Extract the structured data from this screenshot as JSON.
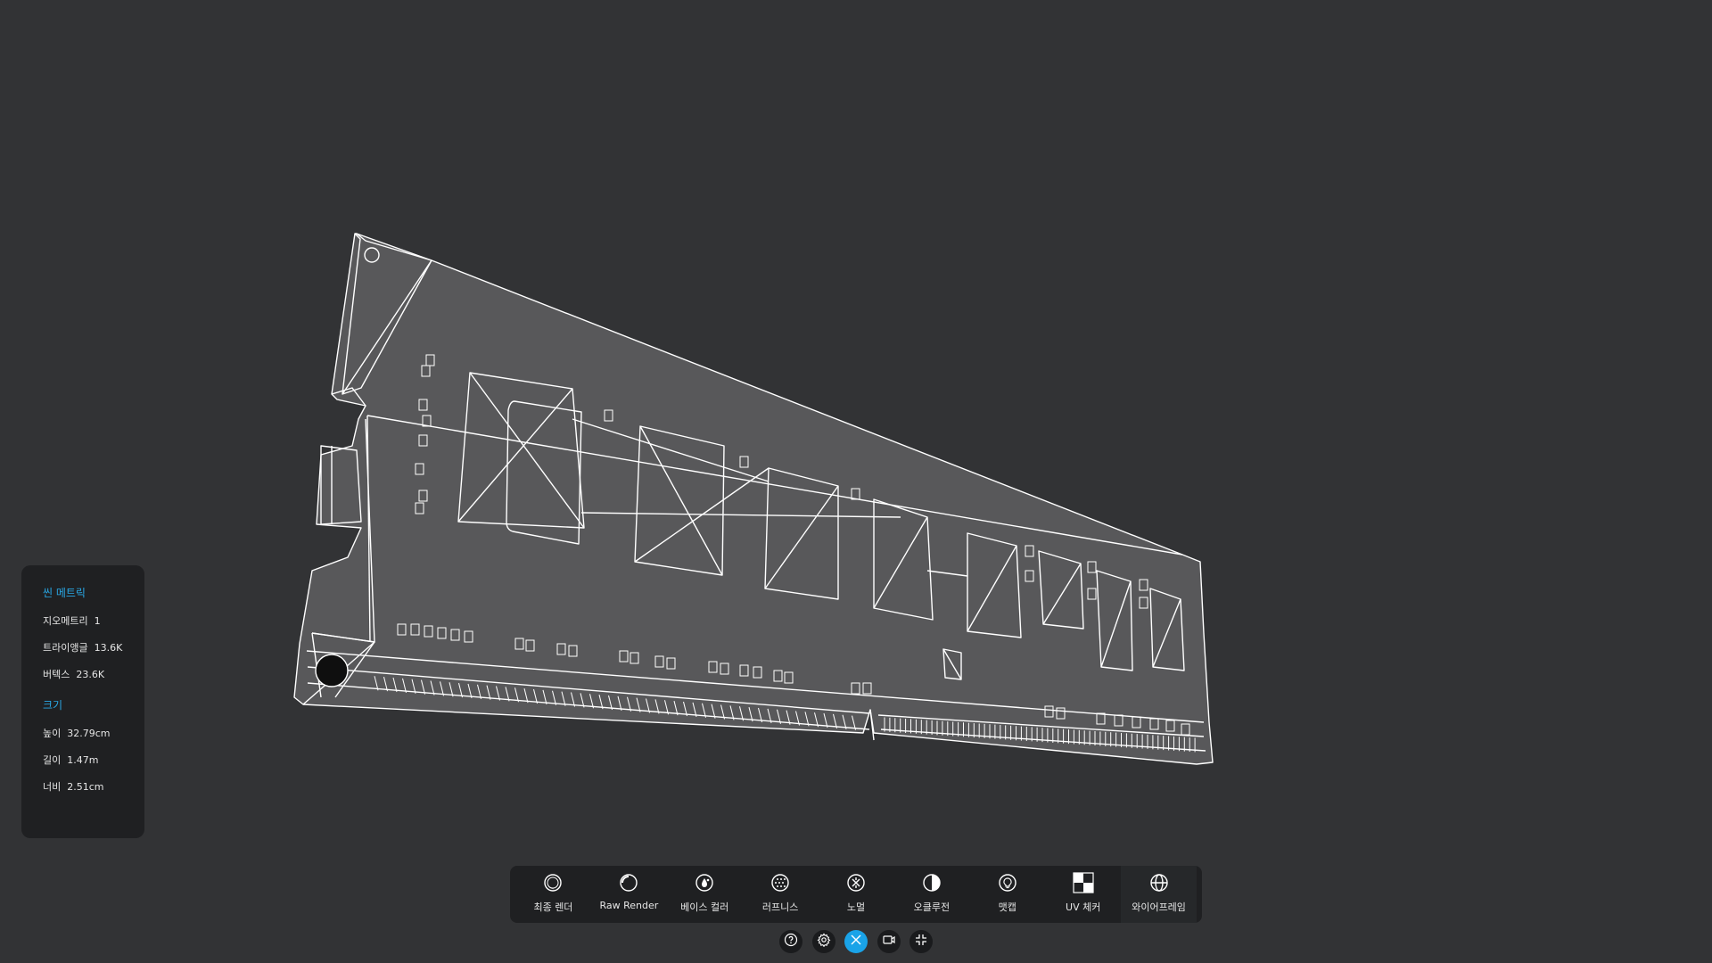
{
  "scene_metrics": {
    "heading": "씬 메트릭",
    "geometry_label": "지오메트리",
    "geometry_value": "1",
    "triangles_label": "트라이앵글",
    "triangles_value": "13.6K",
    "vertices_label": "버텍스",
    "vertices_value": "23.6K"
  },
  "dimensions": {
    "heading": "크기",
    "height_label": "높이",
    "height_value": "32.79cm",
    "length_label": "길이",
    "length_value": "1.47m",
    "width_label": "너비",
    "width_value": "2.51cm"
  },
  "toolbar": {
    "active_tool": "와이어프레임",
    "tools": [
      {
        "label": "최종 렌더",
        "icon": "final-render-icon"
      },
      {
        "label": "Raw Render",
        "icon": "raw-render-icon"
      },
      {
        "label": "베이스 컬러",
        "icon": "base-color-icon"
      },
      {
        "label": "러프니스",
        "icon": "roughness-icon"
      },
      {
        "label": "노멀",
        "icon": "normal-icon"
      },
      {
        "label": "오클루전",
        "icon": "occlusion-icon"
      },
      {
        "label": "맷캡",
        "icon": "matcap-icon"
      },
      {
        "label": "UV 체커",
        "icon": "uv-checker-icon"
      },
      {
        "label": "와이어프레임",
        "icon": "wireframe-icon"
      }
    ]
  },
  "controls": [
    {
      "icon": "help-icon",
      "active": false
    },
    {
      "icon": "gear-icon",
      "active": false
    },
    {
      "icon": "tools-icon",
      "active": true
    },
    {
      "icon": "video-camera-icon",
      "active": false
    },
    {
      "icon": "exit-fullscreen-icon",
      "active": false
    }
  ],
  "colors": {
    "background": "#323335",
    "panel": "#1f2022",
    "accent": "#29a8e6",
    "active_control": "#1aa3e8",
    "wire": "#ffffff",
    "model_fill": "#5a5a5c"
  }
}
